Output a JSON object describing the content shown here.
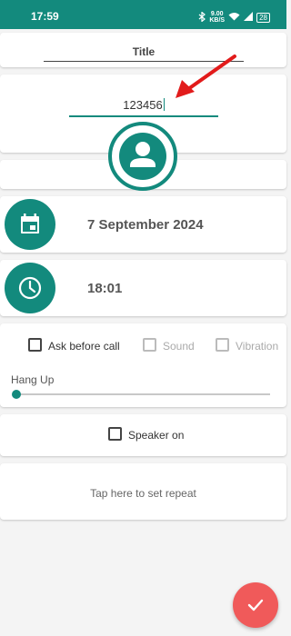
{
  "status_bar": {
    "time": "17:59",
    "speed_value": "9.00",
    "speed_unit": "KB/S",
    "battery": "28"
  },
  "form": {
    "title_placeholder": "Title",
    "number_value": "123456"
  },
  "schedule": {
    "date": "7 September 2024",
    "time": "18:01"
  },
  "options": {
    "ask_before_call": {
      "label": "Ask before call",
      "checked": false
    },
    "sound": {
      "label": "Sound",
      "enabled": false
    },
    "vibration": {
      "label": "Vibration",
      "enabled": false
    }
  },
  "hang_up": {
    "label": "Hang Up",
    "value_fraction": 0.0
  },
  "speaker": {
    "label": "Speaker on",
    "checked": false
  },
  "repeat": {
    "text": "Tap here to set repeat"
  },
  "colors": {
    "primary": "#138a7d",
    "fab": "#f05a5a",
    "annotation_arrow": "#e21b1b"
  },
  "icons": {
    "contact": "person-icon",
    "date": "calendar-icon",
    "time": "clock-icon",
    "fab": "check-icon"
  }
}
